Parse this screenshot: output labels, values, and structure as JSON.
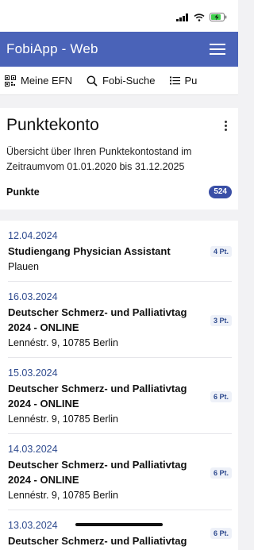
{
  "app": {
    "title": "FobiApp - Web"
  },
  "nav": [
    {
      "label": "Meine EFN",
      "icon": "qr-code-icon"
    },
    {
      "label": "Fobi-Suche",
      "icon": "search-icon"
    },
    {
      "label": "Pu",
      "icon": "list-icon"
    }
  ],
  "account": {
    "title": "Punktekonto",
    "description": "Übersicht über Ihren Punktekontostand im Zeitraumvom 01.01.2020 bis 31.12.2025",
    "points_label": "Punkte",
    "points_total": "524"
  },
  "entries": [
    {
      "date": "12.04.2024",
      "title": "Studiengang Physician Assistant",
      "location": "Plauen",
      "points": "4 Pt."
    },
    {
      "date": "16.03.2024",
      "title": "Deutscher Schmerz- und Palliativtag 2024 - ONLINE",
      "location": "Lennéstr. 9, 10785 Berlin",
      "points": "3 Pt."
    },
    {
      "date": "15.03.2024",
      "title": "Deutscher Schmerz- und Palliativtag 2024 - ONLINE",
      "location": "Lennéstr. 9, 10785 Berlin",
      "points": "6 Pt."
    },
    {
      "date": "14.03.2024",
      "title": "Deutscher Schmerz- und Palliativtag 2024 - ONLINE",
      "location": "Lennéstr. 9, 10785 Berlin",
      "points": "6 Pt."
    },
    {
      "date": "13.03.2024",
      "title": "Deutscher Schmerz- und Palliativtag",
      "location": "",
      "points": "6 Pt."
    }
  ],
  "colors": {
    "appbar": "#4a63b8",
    "accent": "#2f4b8f"
  }
}
